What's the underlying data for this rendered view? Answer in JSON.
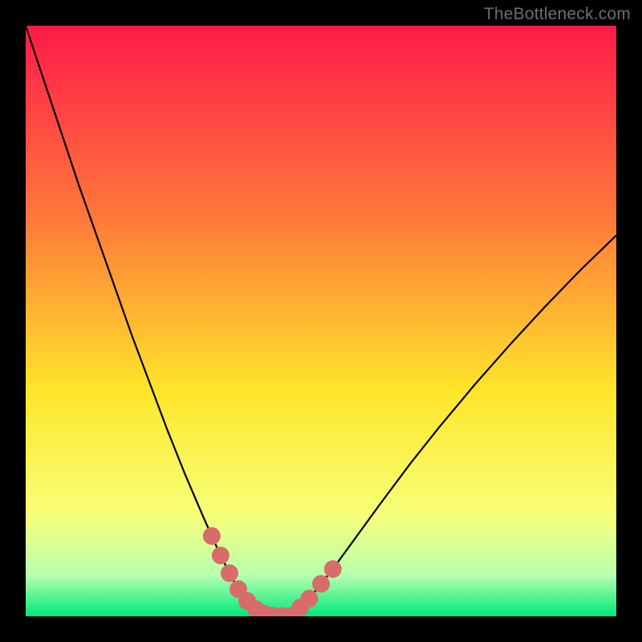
{
  "watermark": "TheBottleneck.com",
  "colors": {
    "background_black": "#000000",
    "gradient_top": "#ff1a49",
    "gradient_mid1": "#ff7a3a",
    "gradient_mid2": "#ffe62a",
    "gradient_low": "#f6ff7a",
    "gradient_bottom_light": "#b8ffb0",
    "gradient_bottom": "#00e87b",
    "curve_stroke": "#000000",
    "marker_fill": "#d96b6b",
    "watermark_text": "#6e6e6e"
  },
  "chart_data": {
    "type": "line",
    "title": "",
    "xlabel": "",
    "ylabel": "",
    "xlim": [
      0,
      100
    ],
    "ylim": [
      0,
      100
    ],
    "series": [
      {
        "name": "bottleneck-curve",
        "x": [
          0,
          3,
          6,
          9,
          12,
          15,
          18,
          21,
          24,
          27,
          30,
          31.5,
          33,
          34.5,
          36,
          37.5,
          39,
          40.5,
          42,
          45,
          48,
          52,
          56,
          60,
          65,
          70,
          76,
          82,
          88,
          94,
          100
        ],
        "y": [
          100,
          91,
          82,
          73,
          64.5,
          56,
          47.5,
          39.5,
          31.5,
          24,
          17,
          13.6,
          10.3,
          7.3,
          4.6,
          2.6,
          1.2,
          0.4,
          0.1,
          0.05,
          3.0,
          8.0,
          13.5,
          19.0,
          25.7,
          32.0,
          39.2,
          46.0,
          52.5,
          58.7,
          64.5
        ]
      }
    ],
    "markers": [
      {
        "x": 31.5,
        "y": 13.6
      },
      {
        "x": 33.0,
        "y": 10.3
      },
      {
        "x": 34.5,
        "y": 7.3
      },
      {
        "x": 36.0,
        "y": 4.6
      },
      {
        "x": 37.5,
        "y": 2.6
      },
      {
        "x": 39.0,
        "y": 1.2
      },
      {
        "x": 40.5,
        "y": 0.4
      },
      {
        "x": 42.0,
        "y": 0.1
      },
      {
        "x": 43.5,
        "y": 0.05
      },
      {
        "x": 45.0,
        "y": 0.05
      },
      {
        "x": 46.5,
        "y": 1.5
      },
      {
        "x": 48.0,
        "y": 3.0
      },
      {
        "x": 50.0,
        "y": 5.5
      },
      {
        "x": 52.0,
        "y": 8.0
      }
    ],
    "annotations": []
  }
}
